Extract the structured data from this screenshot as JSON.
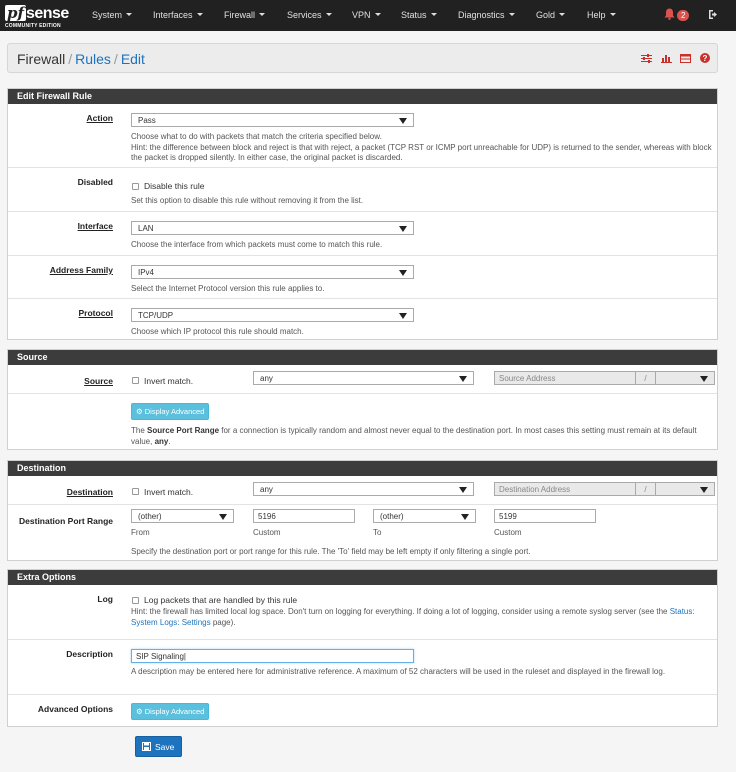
{
  "navbar": {
    "logo_pf": "pf",
    "logo_sense": "sense",
    "logo_edition": "COMMUNITY EDITION",
    "menus": [
      "System",
      "Interfaces",
      "Firewall",
      "Services",
      "VPN",
      "Status",
      "Diagnostics",
      "Gold",
      "Help"
    ],
    "notification_count": "2"
  },
  "breadcrumb": {
    "part1": "Firewall",
    "part2": "Rules",
    "part3": "Edit"
  },
  "edit_rule": {
    "title": "Edit Firewall Rule",
    "action_label": "Action",
    "action_value": "Pass",
    "action_help": "Choose what to do with packets that match the criteria specified below.",
    "action_help2": "Hint: the difference between block and reject is that with reject, a packet (TCP RST or ICMP port unreachable for UDP) is returned to the sender, whereas with block the packet is dropped silently. In either case, the original packet is discarded.",
    "disabled_label": "Disabled",
    "disabled_checkbox": "Disable this rule",
    "disabled_help": "Set this option to disable this rule without removing it from the list.",
    "interface_label": "Interface",
    "interface_value": "LAN",
    "interface_help": "Choose the interface from which packets must come to match this rule.",
    "family_label": "Address Family",
    "family_value": "IPv4",
    "family_help": "Select the Internet Protocol version this rule applies to.",
    "protocol_label": "Protocol",
    "protocol_value": "TCP/UDP",
    "protocol_help": "Choose which IP protocol this rule should match."
  },
  "source": {
    "title": "Source",
    "label": "Source",
    "invert": "Invert match.",
    "type_value": "any",
    "address_placeholder": "Source Address",
    "slash": "/",
    "display_advanced": "Display Advanced",
    "help_pre": "The ",
    "help_bold": "Source Port Range",
    "help_mid": " for a connection is typically random and almost never equal to the destination port. In most cases this setting must remain at its default value, ",
    "help_bold2": "any",
    "help_end": "."
  },
  "destination": {
    "title": "Destination",
    "label": "Destination",
    "invert": "Invert match.",
    "type_value": "any",
    "address_placeholder": "Destination Address",
    "slash": "/",
    "port_range_label": "Destination Port Range",
    "from_select": "(other)",
    "from_custom": "5196",
    "to_select": "(other)",
    "to_custom": "5199",
    "from_caption": "From",
    "custom_caption": "Custom",
    "to_caption": "To",
    "custom_caption2": "Custom",
    "help": "Specify the destination port or port range for this rule. The 'To' field may be left empty if only filtering a single port."
  },
  "extra": {
    "title": "Extra Options",
    "log_label": "Log",
    "log_checkbox": "Log packets that are handled by this rule",
    "log_help": "Hint: the firewall has limited local log space. Don't turn on logging for everything. If doing a lot of logging, consider using a remote syslog server (see the ",
    "log_help_link": "Status: System Logs: Settings",
    "log_help_end": " page).",
    "desc_label": "Description",
    "desc_value": "SIP Signaling",
    "desc_help": "A description may be entered here for administrative reference. A maximum of 52 characters will be used in the ruleset and displayed in the firewall log.",
    "adv_label": "Advanced Options",
    "display_advanced": "Display Advanced"
  },
  "save_label": "Save",
  "colors": {
    "navbar": "#212121",
    "panel_header": "#3c3c3c",
    "link": "#1e73be",
    "advanced_button": "#5bc0de",
    "save_button": "#1e73be",
    "badge": "#d9534f"
  }
}
